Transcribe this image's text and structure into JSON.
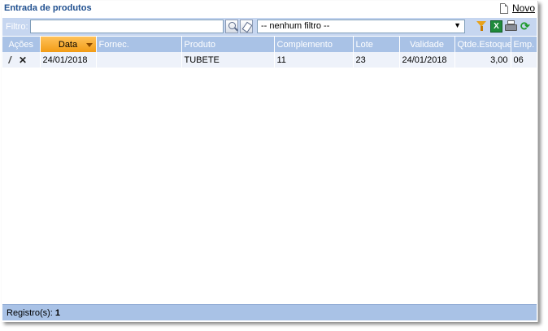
{
  "window": {
    "title": "Entrada de produtos",
    "new_label": "Novo"
  },
  "filter": {
    "label": "Filtro:",
    "value": "",
    "select_value": "-- nenhum filtro --",
    "export_label": "X"
  },
  "grid": {
    "columns": [
      "Ações",
      "Data",
      "Fornec.",
      "Produto",
      "Complemento",
      "Lote",
      "Validade",
      "Qtde.Estoque",
      "Emp."
    ],
    "sorted_column": "Data",
    "rows": [
      {
        "data": "24/01/2018",
        "fornec": "",
        "produto": "TUBETE",
        "complemento": "11",
        "lote": "23",
        "validade": "24/01/2018",
        "qtde": "3,00",
        "emp": "06"
      }
    ]
  },
  "status": {
    "label": "Registro(s):",
    "count": "1"
  },
  "icons": [
    "new-document-icon",
    "search-icon",
    "eraser-icon",
    "funnel-icon",
    "excel-icon",
    "printer-icon",
    "refresh-icon",
    "pencil-icon",
    "delete-icon",
    "sort-desc-icon"
  ],
  "colors": {
    "title": "#1f4f8f",
    "header": "#a9c2e6",
    "sorted_header": "#f29c16",
    "row": "#eef2fa",
    "filterbar": "#c6d6f0"
  }
}
